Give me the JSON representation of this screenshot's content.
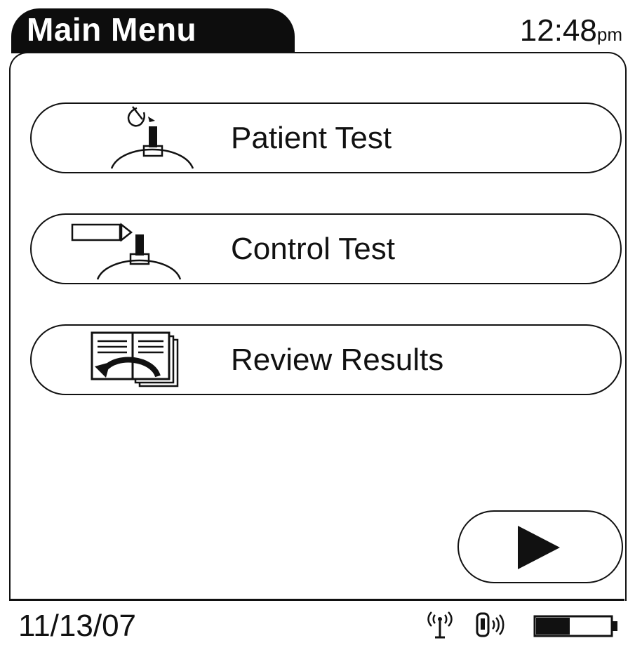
{
  "header": {
    "title": "Main Menu",
    "time": "12:48",
    "time_suffix": "pm"
  },
  "menu": {
    "items": [
      {
        "label": "Patient Test",
        "icon": "patient-test-icon"
      },
      {
        "label": "Control Test",
        "icon": "control-test-icon"
      },
      {
        "label": "Review Results",
        "icon": "review-results-icon"
      }
    ],
    "next_icon": "play-arrow-icon"
  },
  "footer": {
    "date": "11/13/07",
    "icons": [
      "wireless-antenna-icon",
      "device-signal-icon",
      "battery-icon"
    ],
    "battery_level": 0.45
  }
}
